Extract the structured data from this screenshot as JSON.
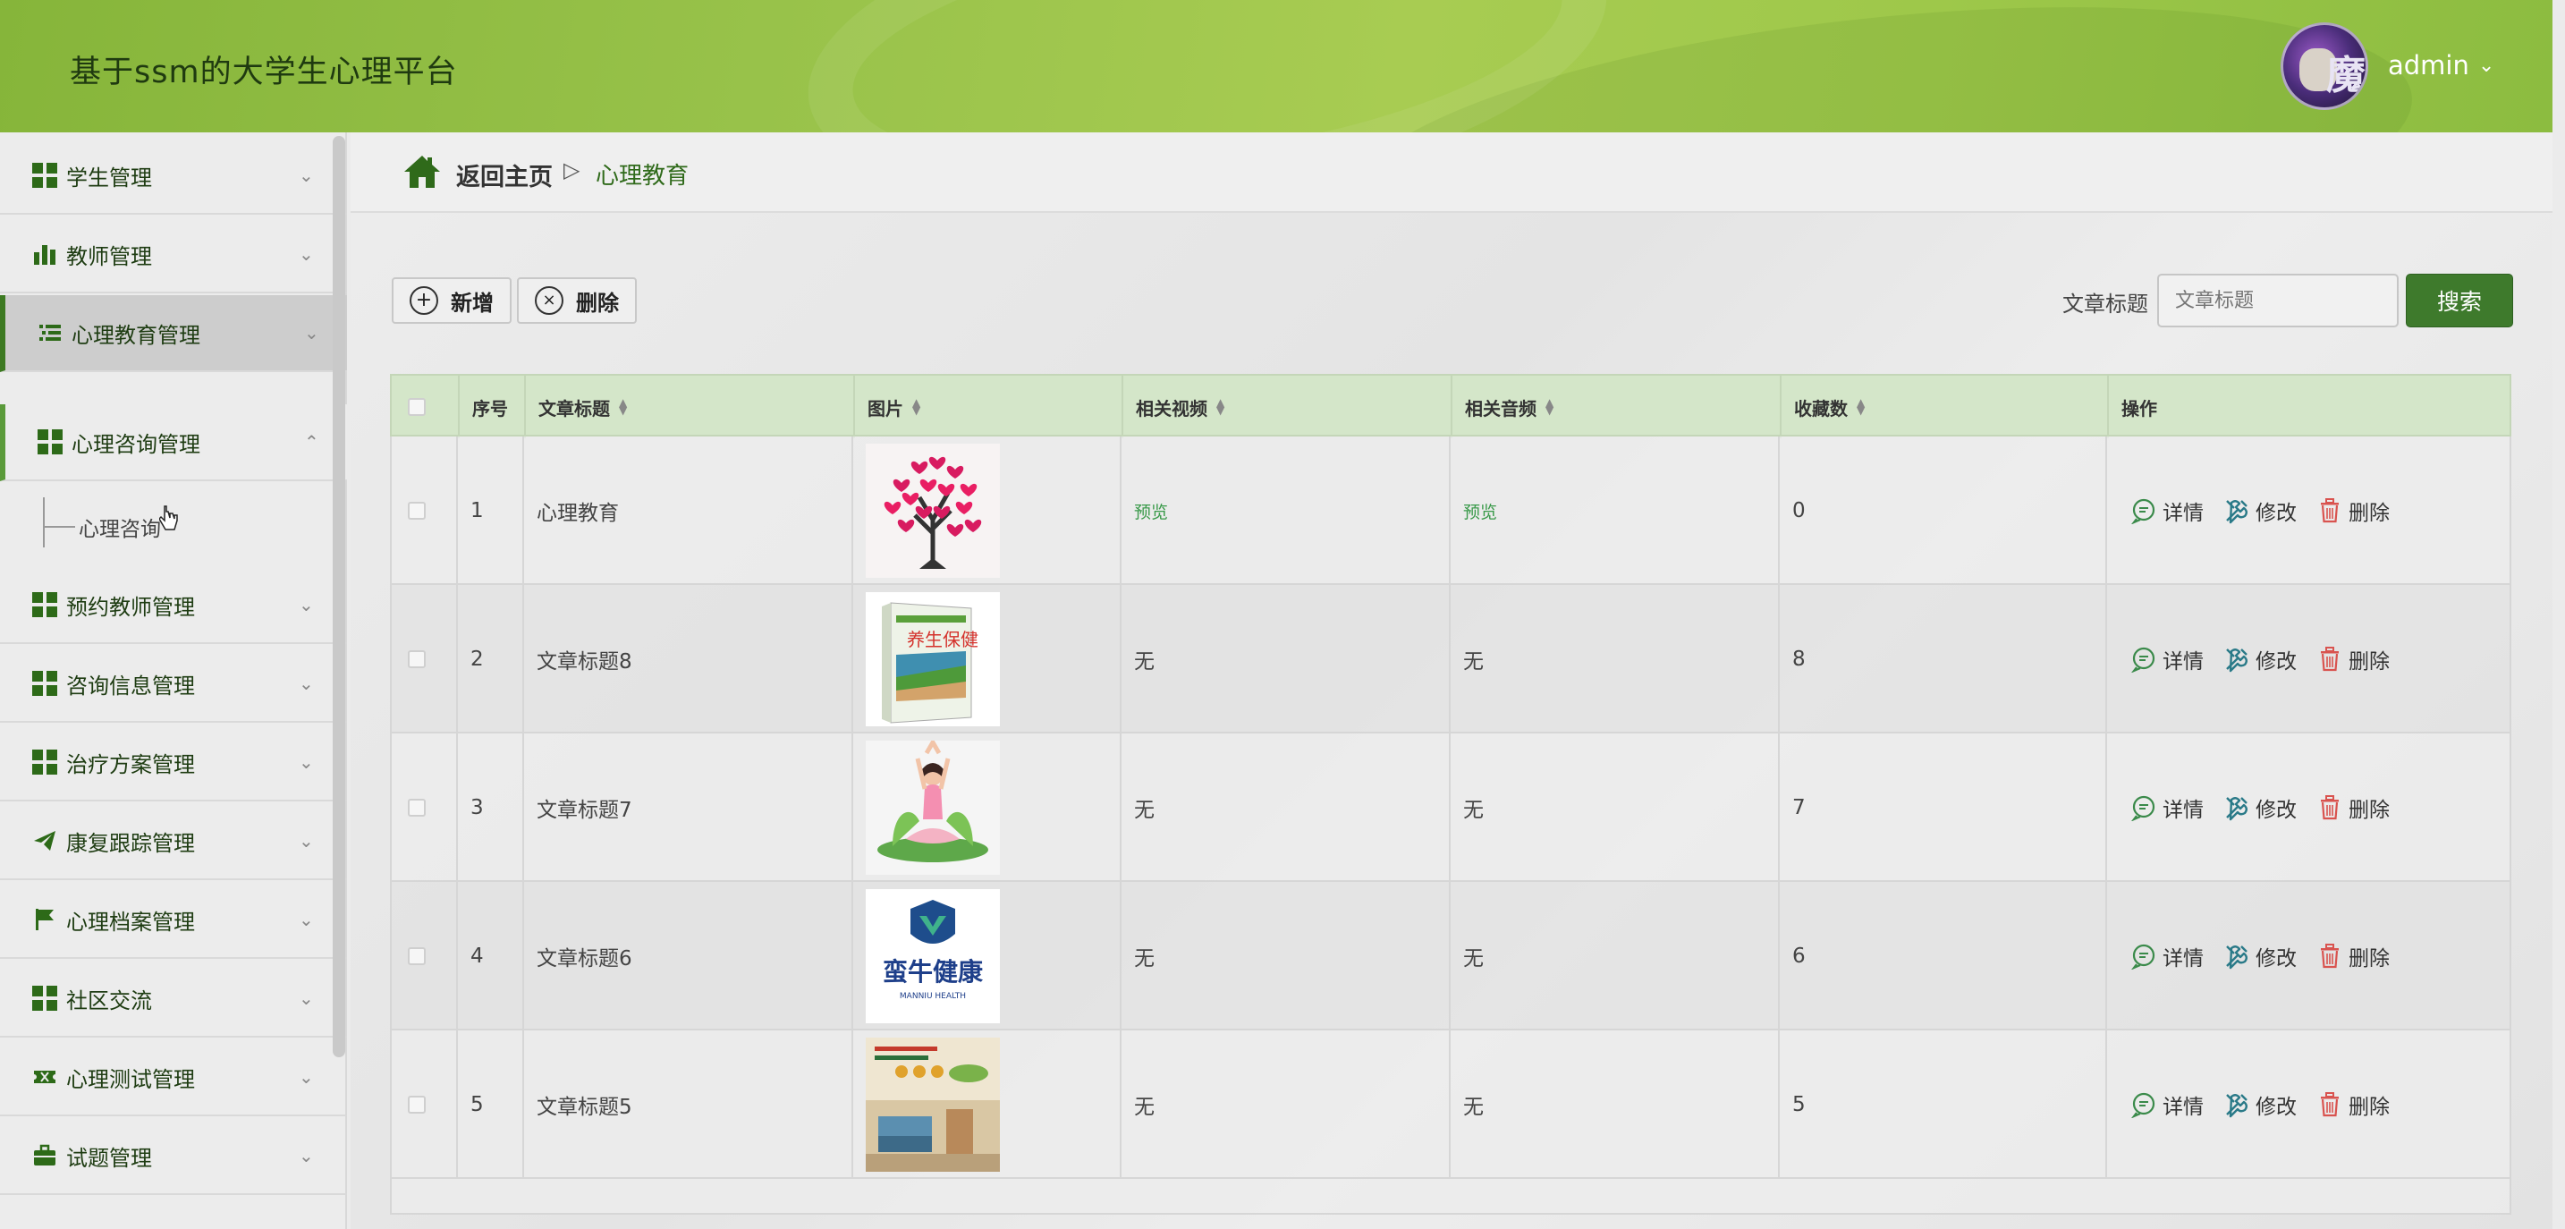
{
  "header": {
    "title": "基于ssm的大学生心理平台",
    "user": "admin",
    "user_caret": "⌄",
    "avatar_glyph": "魔"
  },
  "sidebar": {
    "items": [
      {
        "label": "学生管理",
        "icon": "grid-icon"
      },
      {
        "label": "教师管理",
        "icon": "bar-chart-icon"
      },
      {
        "label": "心理教育管理",
        "icon": "list-icon"
      },
      {
        "label": "心理咨询管理",
        "icon": "grid-icon"
      },
      {
        "label": "预约教师管理",
        "icon": "grid-icon"
      },
      {
        "label": "咨询信息管理",
        "icon": "grid-icon"
      },
      {
        "label": "治疗方案管理",
        "icon": "grid-icon"
      },
      {
        "label": "康复跟踪管理",
        "icon": "paper-plane-icon"
      },
      {
        "label": "心理档案管理",
        "icon": "flag-icon"
      },
      {
        "label": "社区交流",
        "icon": "grid-icon"
      },
      {
        "label": "心理测试管理",
        "icon": "ticket-icon"
      },
      {
        "label": "试题管理",
        "icon": "briefcase-icon"
      }
    ],
    "sub_item": "心理咨询",
    "arrow_down": "⌄",
    "arrow_up": "⌃"
  },
  "breadcrumb": {
    "back": "返回主页",
    "separator": "▷",
    "current": "心理教育"
  },
  "toolbar": {
    "add_label": "新增",
    "delete_label": "删除",
    "search_label": "文章标题",
    "search_placeholder": "文章标题",
    "search_button": "搜索"
  },
  "table": {
    "headers": [
      "序号",
      "文章标题",
      "图片",
      "相关视频",
      "相关音频",
      "收藏数",
      "操作"
    ],
    "rows": [
      {
        "no": "1",
        "title": "心理教育",
        "image": "heart-tree-image",
        "video": "预览",
        "audio": "预览",
        "favorites": "0"
      },
      {
        "no": "2",
        "title": "文章标题8",
        "image": "health-book-image",
        "video": "无",
        "audio": "无",
        "favorites": "8"
      },
      {
        "no": "3",
        "title": "文章标题7",
        "image": "yoga-image",
        "video": "无",
        "audio": "无",
        "favorites": "7"
      },
      {
        "no": "4",
        "title": "文章标题6",
        "image": "manniu-logo-image",
        "video": "无",
        "audio": "无",
        "favorites": "6"
      },
      {
        "no": "5",
        "title": "文章标题5",
        "image": "poster-image",
        "video": "无",
        "audio": "无",
        "favorites": "5"
      }
    ],
    "actions": {
      "detail": "详情",
      "edit": "修改",
      "delete": "删除"
    }
  },
  "images": {
    "logo_brand": "蛮牛健康",
    "logo_sub": "MANNIU HEALTH",
    "book_title": "养生保健"
  },
  "colors": {
    "header_green": "#98c24a",
    "brand_dark_green": "#3e7a2c",
    "table_header": "#d4e6c9",
    "delete_red": "#d9534f"
  }
}
